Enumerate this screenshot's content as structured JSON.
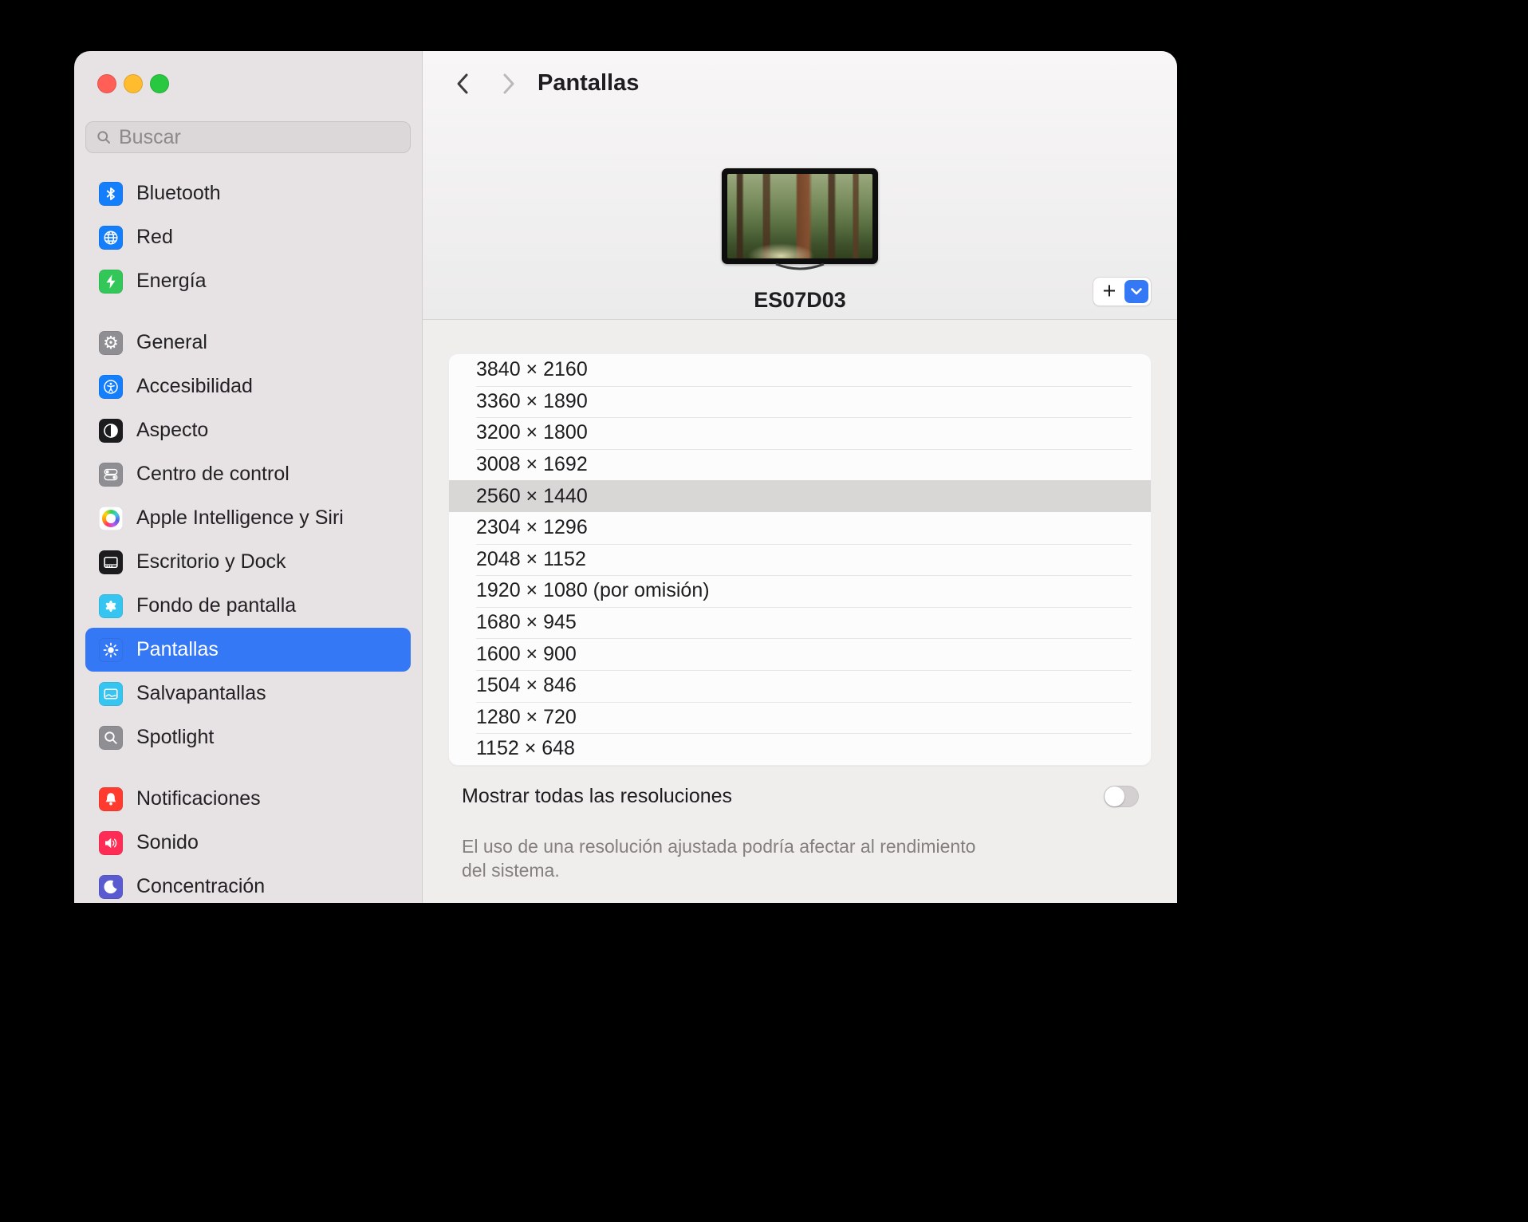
{
  "window": {
    "traffic_lights": {
      "close": "close-button",
      "minimize": "minimize-button",
      "zoom": "zoom-button"
    }
  },
  "sidebar": {
    "search": {
      "placeholder": "Buscar",
      "icon": "search-icon"
    },
    "groups": [
      {
        "items": [
          {
            "id": "bluetooth",
            "label": "Bluetooth",
            "icon": "bluetooth-icon",
            "color": "#147efb"
          },
          {
            "id": "red",
            "label": "Red",
            "icon": "globe-icon",
            "color": "#147efb"
          },
          {
            "id": "energia",
            "label": "Energía",
            "icon": "bolt-icon",
            "color": "#33c759"
          }
        ]
      },
      {
        "items": [
          {
            "id": "general",
            "label": "General",
            "icon": "gear-icon",
            "color": "#8e8e93"
          },
          {
            "id": "accesibilidad",
            "label": "Accesibilidad",
            "icon": "accessibility-icon",
            "color": "#147efb"
          },
          {
            "id": "aspecto",
            "label": "Aspecto",
            "icon": "appearance-icon",
            "color": "#1c1c1e"
          },
          {
            "id": "centro-de-control",
            "label": "Centro de control",
            "icon": "control-center-icon",
            "color": "#8e8e93"
          },
          {
            "id": "apple-intelligence-y-siri",
            "label": "Apple Intelligence y Siri",
            "icon": "siri-icon",
            "color": "#ffffff"
          },
          {
            "id": "escritorio-y-dock",
            "label": "Escritorio y Dock",
            "icon": "dock-icon",
            "color": "#1c1c1e"
          },
          {
            "id": "fondo-de-pantalla",
            "label": "Fondo de pantalla",
            "icon": "wallpaper-icon",
            "color": "#35c5f0"
          },
          {
            "id": "pantallas",
            "label": "Pantallas",
            "icon": "brightness-icon",
            "color": "#3578f6",
            "selected": true
          },
          {
            "id": "salvapantallas",
            "label": "Salvapantallas",
            "icon": "screensaver-icon",
            "color": "#35c5f0"
          },
          {
            "id": "spotlight",
            "label": "Spotlight",
            "icon": "spotlight-icon",
            "color": "#8e8e93"
          }
        ]
      },
      {
        "items": [
          {
            "id": "notificaciones",
            "label": "Notificaciones",
            "icon": "bell-icon",
            "color": "#ff3b30"
          },
          {
            "id": "sonido",
            "label": "Sonido",
            "icon": "speaker-icon",
            "color": "#ff2d55"
          },
          {
            "id": "concentracion",
            "label": "Concentración",
            "icon": "moon-icon",
            "color": "#5a5ad1"
          }
        ]
      }
    ]
  },
  "header": {
    "title": "Pantallas",
    "back_icon": "chevron-left-icon",
    "forward_icon": "chevron-right-icon"
  },
  "display": {
    "name": "ES07D03",
    "add_button_label": "+",
    "add_icon": "plus-icon",
    "dropdown_icon": "chevron-down-icon",
    "accent_color": "#3578f6"
  },
  "resolutions": {
    "items": [
      {
        "label": "3840 × 2160"
      },
      {
        "label": "3360 × 1890"
      },
      {
        "label": "3200 × 1800"
      },
      {
        "label": "3008 × 1692"
      },
      {
        "label": "2560 × 1440",
        "selected": true
      },
      {
        "label": "2304 × 1296"
      },
      {
        "label": "2048 × 1152"
      },
      {
        "label": "1920 × 1080 (por omisión)"
      },
      {
        "label": "1680 × 945"
      },
      {
        "label": "1600 × 900"
      },
      {
        "label": "1504 × 846"
      },
      {
        "label": "1280 × 720"
      },
      {
        "label": "1152 × 648"
      }
    ],
    "show_all_label": "Mostrar todas las resoluciones",
    "show_all_enabled": false,
    "footnote_line1": "El uso de una resolución ajustada podría afectar al rendimiento",
    "footnote_line2": "del sistema."
  }
}
